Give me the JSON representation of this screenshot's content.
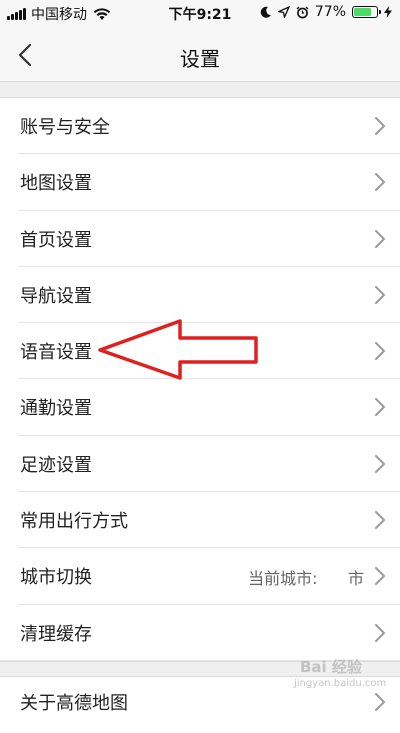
{
  "status_bar": {
    "carrier": "中国移动",
    "time": "下午9:21",
    "battery_percent": "77%",
    "battery_level": 0.77,
    "battery_color": "#4cd964"
  },
  "nav": {
    "title": "设置",
    "back_icon": "chevron-left-icon"
  },
  "settings_items": [
    {
      "label": "账号与安全"
    },
    {
      "label": "地图设置"
    },
    {
      "label": "首页设置"
    },
    {
      "label": "导航设置"
    },
    {
      "label": "语音设置"
    },
    {
      "label": "通勤设置"
    },
    {
      "label": "足迹设置"
    },
    {
      "label": "常用出行方式"
    },
    {
      "label": "城市切换",
      "value": "当前城市:      市"
    },
    {
      "label": "清理缓存"
    }
  ],
  "about": {
    "label": "关于高德地图"
  },
  "annotation": {
    "color": "#e02020",
    "points_to": "语音设置"
  },
  "watermark": {
    "main": "Bai 经验",
    "sub": "jingyan.baidu.com"
  }
}
